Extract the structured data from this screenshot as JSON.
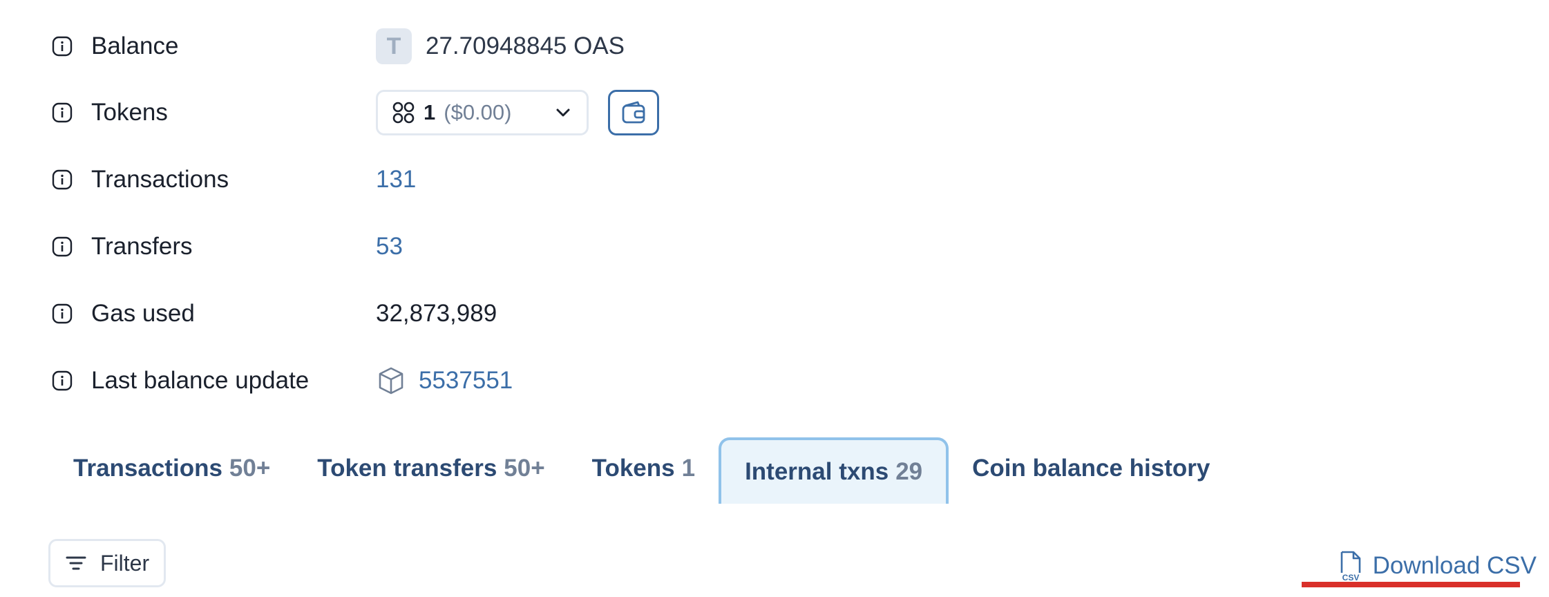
{
  "details": {
    "balance": {
      "label": "Balance",
      "badge": "T",
      "value": "27.70948845 OAS"
    },
    "tokens": {
      "label": "Tokens",
      "count": "1",
      "usd": "($0.00)"
    },
    "transactions": {
      "label": "Transactions",
      "value": "131"
    },
    "transfers": {
      "label": "Transfers",
      "value": "53"
    },
    "gas_used": {
      "label": "Gas used",
      "value": "32,873,989"
    },
    "last_balance_update": {
      "label": "Last balance update",
      "value": "5537551"
    }
  },
  "tabs": [
    {
      "label": "Transactions",
      "count": "50+"
    },
    {
      "label": "Token transfers",
      "count": "50+"
    },
    {
      "label": "Tokens",
      "count": "1"
    },
    {
      "label": "Internal txns",
      "count": "29",
      "active": true
    },
    {
      "label": "Coin balance history",
      "count": ""
    }
  ],
  "actions": {
    "filter_label": "Filter",
    "csv_label": "Download CSV",
    "csv_icon_text": "CSV"
  },
  "colors": {
    "link": "#3b6ea8",
    "tab_text": "#2c4a73",
    "active_tab_bg": "#eaf4fb",
    "active_tab_border": "#90c2ea",
    "highlight_underline": "#d9302a"
  },
  "icons": [
    "info-icon",
    "chevron-down-icon",
    "wallet-icon",
    "grid-icon",
    "cube-icon",
    "filter-icon",
    "csv-file-icon"
  ]
}
